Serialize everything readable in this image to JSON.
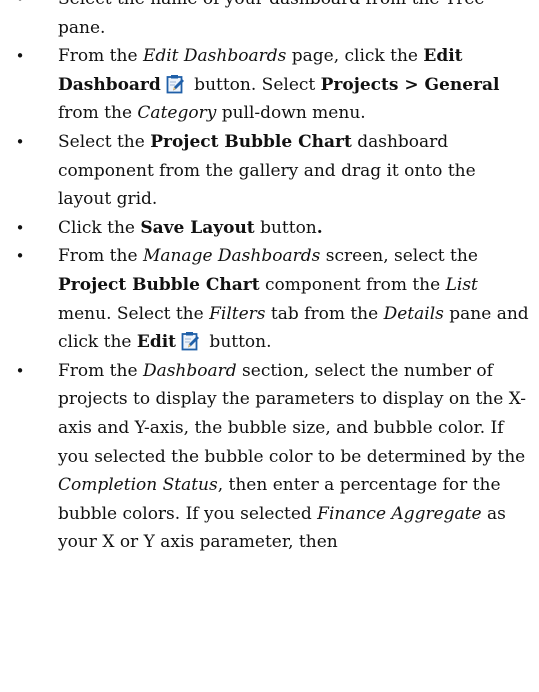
{
  "icons": {
    "edit": "edit-icon"
  },
  "colors": {
    "icon_blue": "#1f5fa8",
    "icon_paper": "#eef4fb"
  },
  "steps": [
    {
      "t1": "Select the name of your dashboard from the Tree pane."
    },
    {
      "t1": "From the ",
      "em1": "Edit Dashboards",
      "t2": " page, click the ",
      "b1": "Edit Dashboard",
      "t3": " button. Select ",
      "b2": "Projects > General",
      "t4": " from the ",
      "em2": "Category",
      "t5": " pull-down menu."
    },
    {
      "t1": "Select the ",
      "b1": "Project Bubble Chart",
      "t2": " dashboard component from the gallery and drag it onto the layout grid."
    },
    {
      "t1": "Click the ",
      "b1": "Save Layout",
      "t2": " button",
      "b2": "."
    },
    {
      "t1": "From the ",
      "em1": "Manage Dashboards",
      "t2": " screen, select the ",
      "b1": "Project Bubble Chart",
      "t3": " component from the ",
      "em2": "List",
      "t4": " menu. Select the ",
      "em3": "Filters",
      "t5": " tab from the ",
      "em4": "Details",
      "t6": " pane and click the ",
      "b2": "Edit",
      "t7": " button."
    },
    {
      "t1": "From the ",
      "em1": "Dashboard",
      "t2": " section, select the number of projects to display the parameters to display on the X-axis and Y-axis, the bubble size, and bubble color. If you selected the bubble color to be determined by the ",
      "em2": "Completion Status",
      "t3": ", then enter a percentage for the bubble colors. If you selected ",
      "em3": "Finance Aggregate",
      "t4": " as your X or Y axis parameter, then"
    }
  ]
}
